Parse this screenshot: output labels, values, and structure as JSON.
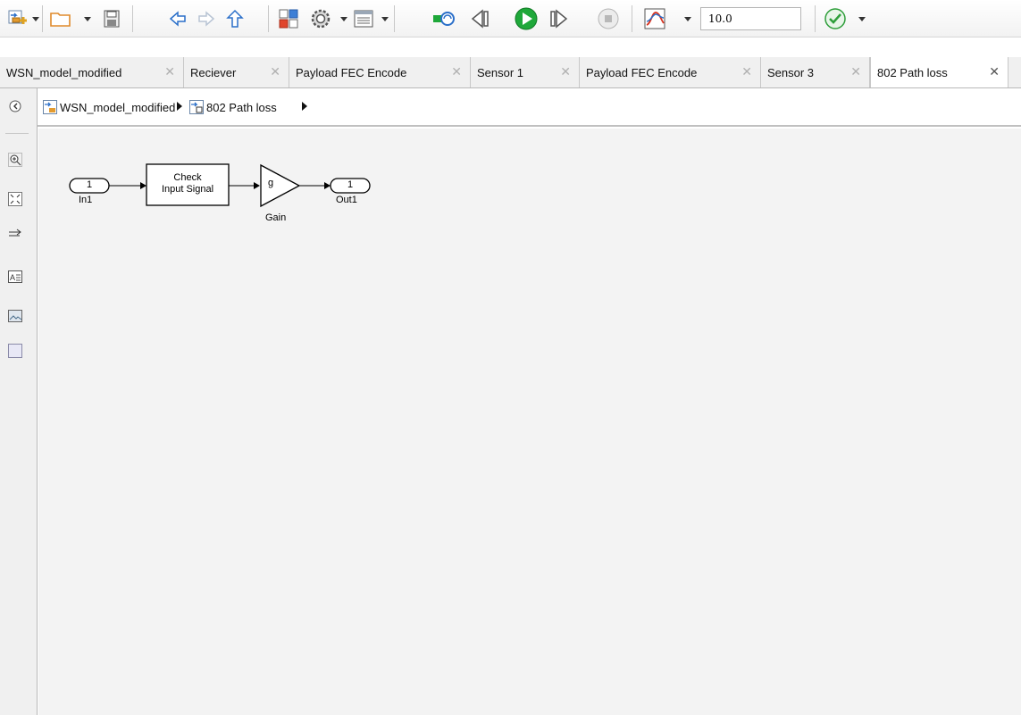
{
  "toolbar": {
    "items": [
      {
        "name": "new-model-icon"
      },
      {
        "name": "open-folder-icon"
      },
      {
        "name": "save-icon"
      },
      {
        "name": "back-arrow-icon"
      },
      {
        "name": "forward-arrow-icon"
      },
      {
        "name": "up-arrow-icon"
      },
      {
        "name": "library-browser-icon"
      },
      {
        "name": "settings-gear-icon"
      },
      {
        "name": "model-explorer-icon"
      },
      {
        "name": "update-diagram-icon"
      },
      {
        "name": "step-back-icon"
      },
      {
        "name": "run-icon"
      },
      {
        "name": "step-forward-icon"
      },
      {
        "name": "stop-icon"
      },
      {
        "name": "scope-record-icon"
      },
      {
        "name": "check-model-icon"
      }
    ],
    "stop_time": "10.0"
  },
  "tabs": [
    {
      "label": "WSN_model_modified",
      "active": false
    },
    {
      "label": "Reciever",
      "active": false
    },
    {
      "label": "Payload FEC Encode",
      "active": false
    },
    {
      "label": "Sensor 1",
      "active": false
    },
    {
      "label": "Payload FEC Encode",
      "active": false
    },
    {
      "label": "Sensor 3",
      "active": false
    },
    {
      "label": "802 Path loss",
      "active": true
    }
  ],
  "tab_close_glyph": "✕",
  "breadcrumb": {
    "items": [
      {
        "label": "WSN_model_modified"
      },
      {
        "label": "802 Path loss"
      }
    ]
  },
  "palette": {
    "items": [
      {
        "name": "hide-explorer-icon"
      },
      {
        "name": "zoom-in-icon"
      },
      {
        "name": "fit-to-view-icon"
      },
      {
        "name": "route-lines-icon"
      },
      {
        "name": "annotation-icon"
      },
      {
        "name": "image-icon"
      },
      {
        "name": "area-icon"
      }
    ]
  },
  "diagram": {
    "inport": {
      "number": "1",
      "label": "In1"
    },
    "check_block": {
      "line1": "Check",
      "line2": "Input Signal"
    },
    "gain": {
      "symbol": "g",
      "label": "Gain"
    },
    "outport": {
      "number": "1",
      "label": "Out1"
    }
  },
  "colors": {
    "run_green": "#1fa83a",
    "check_green": "#2e9e3a",
    "arrow_blue": "#3a7bd5",
    "canvas_bg": "#f3f3f3"
  }
}
